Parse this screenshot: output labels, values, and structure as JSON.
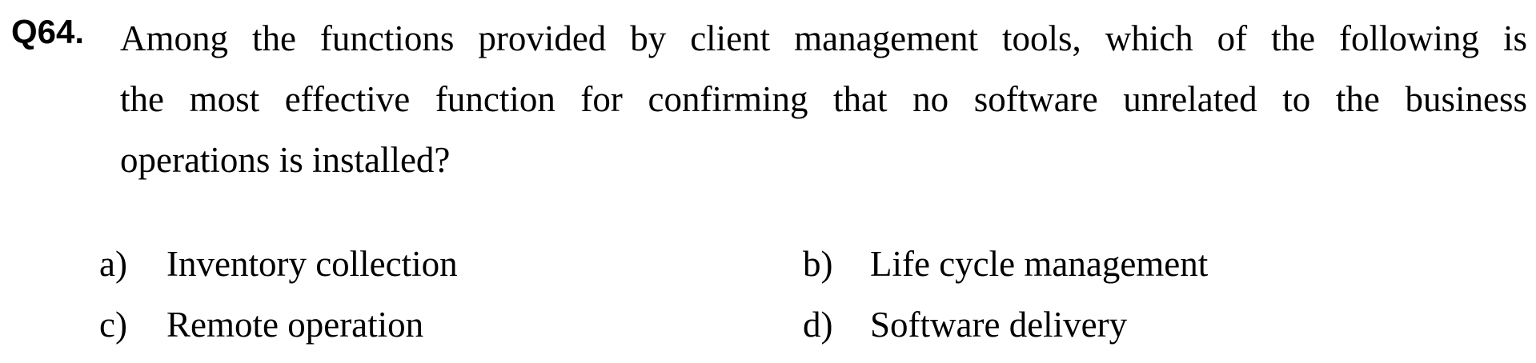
{
  "question": {
    "number": "Q64.",
    "stem_lines": [
      "Among the functions provided by client management tools, which of the following is",
      "the most effective function for confirming that no software unrelated to the business",
      "operations is installed?"
    ]
  },
  "choices": [
    {
      "letter": "a)",
      "text": "Inventory collection"
    },
    {
      "letter": "b)",
      "text": "Life cycle management"
    },
    {
      "letter": "c)",
      "text": "Remote operation"
    },
    {
      "letter": "d)",
      "text": "Software delivery"
    }
  ]
}
